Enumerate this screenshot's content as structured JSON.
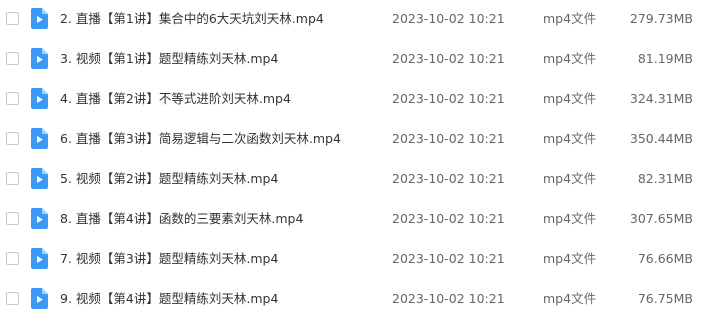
{
  "icon_color": "#3a9af5",
  "files": [
    {
      "name": "2. 直播【第1讲】集合中的6大天坑刘天林.mp4",
      "date": "2023-10-02 10:21",
      "type": "mp4文件",
      "size": "279.73MB",
      "icon": "video-file-icon"
    },
    {
      "name": "3. 视频【第1讲】题型精练刘天林.mp4",
      "date": "2023-10-02 10:21",
      "type": "mp4文件",
      "size": "81.19MB",
      "icon": "video-file-icon"
    },
    {
      "name": "4. 直播【第2讲】不等式进阶刘天林.mp4",
      "date": "2023-10-02 10:21",
      "type": "mp4文件",
      "size": "324.31MB",
      "icon": "video-file-icon"
    },
    {
      "name": "6. 直播【第3讲】简易逻辑与二次函数刘天林.mp4",
      "date": "2023-10-02 10:21",
      "type": "mp4文件",
      "size": "350.44MB",
      "icon": "video-file-icon"
    },
    {
      "name": "5. 视频【第2讲】题型精练刘天林.mp4",
      "date": "2023-10-02 10:21",
      "type": "mp4文件",
      "size": "82.31MB",
      "icon": "video-file-icon"
    },
    {
      "name": "8. 直播【第4讲】函数的三要素刘天林.mp4",
      "date": "2023-10-02 10:21",
      "type": "mp4文件",
      "size": "307.65MB",
      "icon": "video-file-icon"
    },
    {
      "name": "7. 视频【第3讲】题型精练刘天林.mp4",
      "date": "2023-10-02 10:21",
      "type": "mp4文件",
      "size": "76.66MB",
      "icon": "video-file-icon"
    },
    {
      "name": "9. 视频【第4讲】题型精练刘天林.mp4",
      "date": "2023-10-02 10:21",
      "type": "mp4文件",
      "size": "76.75MB",
      "icon": "video-file-icon"
    }
  ]
}
